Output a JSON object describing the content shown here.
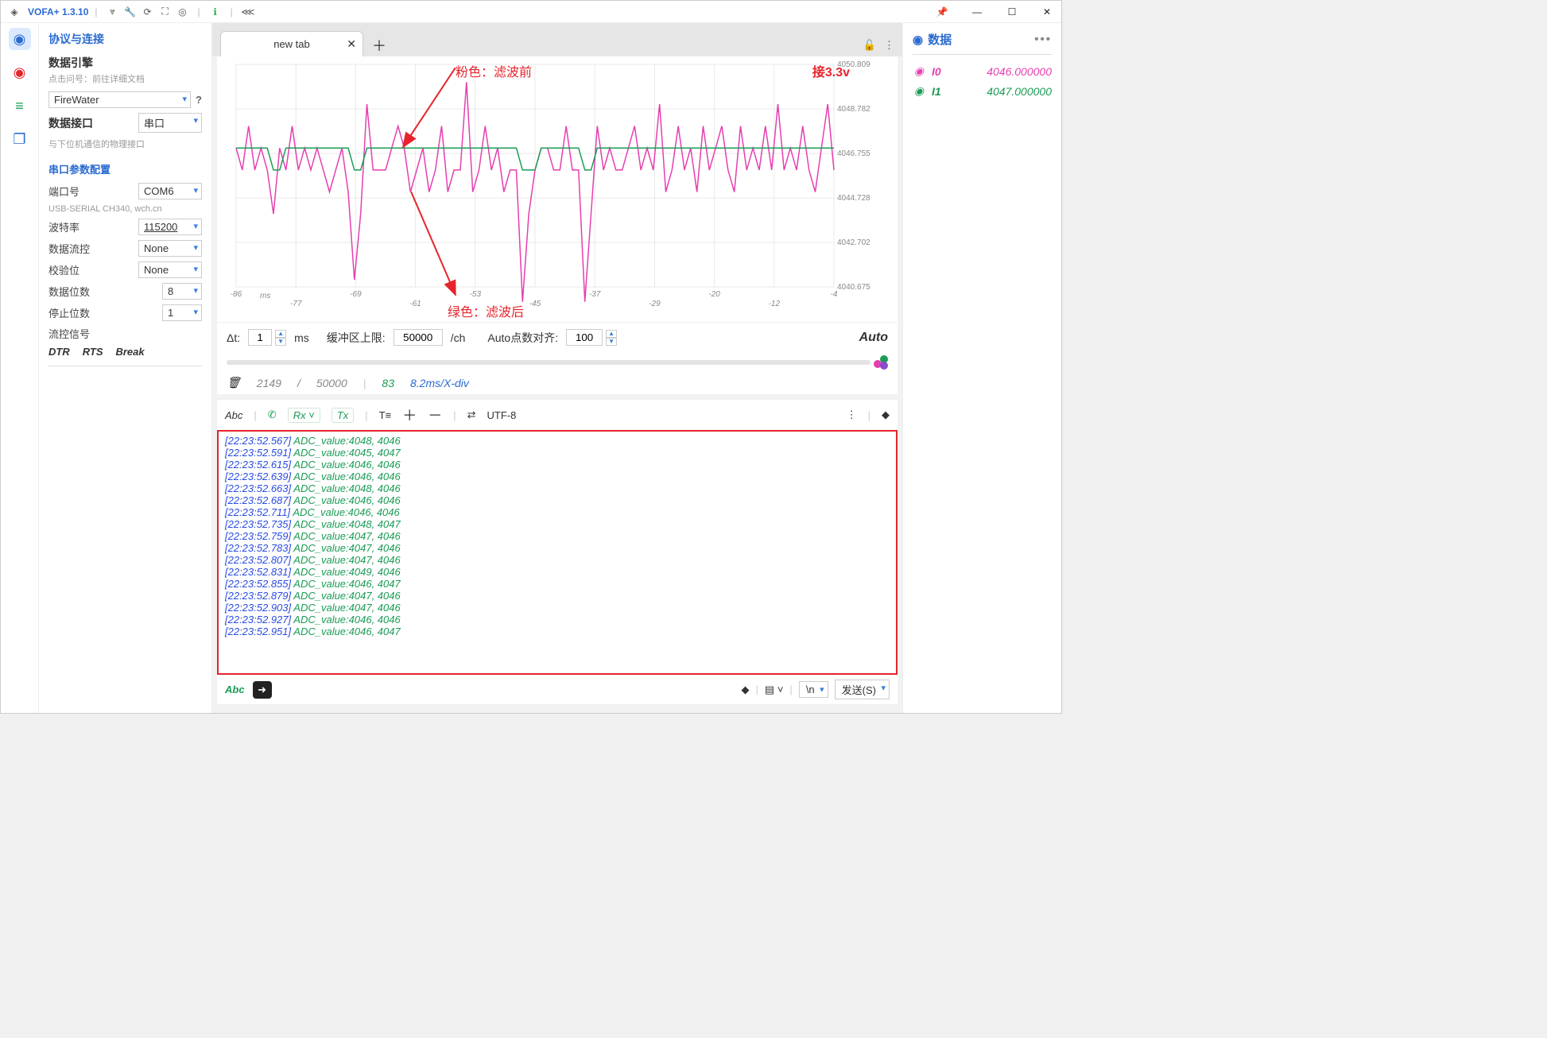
{
  "app": {
    "title": "VOFA+ 1.3.10"
  },
  "window_controls": {
    "pin": "📌",
    "min": "—",
    "max": "☐",
    "close": "✕"
  },
  "sidebar": {
    "title": "协议与连接",
    "engine_label": "数据引擎",
    "engine_sub": "点击问号：前往详细文档",
    "engine_value": "FireWater",
    "iface_label": "数据接口",
    "iface_value": "串口",
    "iface_sub": "与下位机通信的物理接口",
    "serial_title": "串口参数配置",
    "port_label": "端口号",
    "port_value": "COM6",
    "port_desc": "USB-SERIAL CH340, wch.cn",
    "baud_label": "波特率",
    "baud_value": "115200",
    "flow_label": "数据流控",
    "flow_value": "None",
    "parity_label": "校验位",
    "parity_value": "None",
    "databits_label": "数据位数",
    "databits_value": "8",
    "stopbits_label": "停止位数",
    "stopbits_value": "1",
    "flowsig_label": "流控信号",
    "dtr": "DTR",
    "rts": "RTS",
    "break": "Break"
  },
  "tabs": {
    "active": "new tab"
  },
  "chart_data": {
    "type": "line",
    "x_label": "ms",
    "x_ticks": [
      -86,
      -77,
      -69,
      -61,
      -53,
      -45,
      -37,
      -29,
      -20,
      -12,
      -4
    ],
    "ylim": [
      4040.675,
      4050.809
    ],
    "y_ticks": [
      4040.675,
      4042.702,
      4044.728,
      4046.755,
      4048.782,
      4050.809
    ],
    "series": [
      {
        "name": "I0",
        "color": "#e53fb0",
        "values": [
          4047,
          4046,
          4048,
          4046,
          4047,
          4046,
          4044,
          4047,
          4046,
          4048,
          4046,
          4047,
          4046,
          4047,
          4046,
          4045,
          4046,
          4047,
          4045,
          4041,
          4044,
          4049,
          4046,
          4046,
          4046,
          4047,
          4048,
          4047,
          4045,
          4046,
          4047,
          4045,
          4046,
          4048,
          4045,
          4046,
          4046,
          4050,
          4045,
          4046,
          4048,
          4046,
          4047,
          4045,
          4046,
          4046,
          4040,
          4044,
          4046,
          4047,
          4047,
          4046,
          4046,
          4048,
          4046,
          4046,
          4040,
          4044,
          4048,
          4046,
          4047,
          4046,
          4046,
          4047,
          4048,
          4046,
          4047,
          4046,
          4049,
          4045,
          4046,
          4048,
          4046,
          4047,
          4045,
          4048,
          4046,
          4047,
          4048,
          4046,
          4045,
          4048,
          4046,
          4047,
          4046,
          4048,
          4046,
          4049,
          4046,
          4047,
          4046,
          4048,
          4046,
          4045,
          4047,
          4049,
          4046
        ]
      },
      {
        "name": "I1",
        "color": "#1a9c55",
        "values": [
          4047,
          4047,
          4047,
          4047,
          4047,
          4047,
          4046,
          4046,
          4047,
          4047,
          4047,
          4047,
          4047,
          4047,
          4047,
          4047,
          4047,
          4047,
          4047,
          4046,
          4046,
          4047,
          4047,
          4047,
          4047,
          4047,
          4047,
          4047,
          4047,
          4047,
          4047,
          4047,
          4047,
          4047,
          4047,
          4047,
          4047,
          4047,
          4047,
          4047,
          4047,
          4047,
          4047,
          4047,
          4047,
          4047,
          4046,
          4046,
          4046,
          4047,
          4047,
          4047,
          4047,
          4047,
          4047,
          4047,
          4046,
          4046,
          4047,
          4047,
          4047,
          4047,
          4047,
          4047,
          4047,
          4047,
          4047,
          4047,
          4047,
          4047,
          4047,
          4047,
          4047,
          4047,
          4047,
          4047,
          4047,
          4047,
          4047,
          4047,
          4047,
          4047,
          4047,
          4047,
          4047,
          4047,
          4047,
          4047,
          4047,
          4047,
          4047,
          4047,
          4047,
          4047,
          4047,
          4047,
          4047
        ]
      }
    ],
    "annotations": {
      "pink_label": "粉色：滤波前",
      "green_label": "绿色：滤波后",
      "voltage": "接3.3v"
    }
  },
  "controls": {
    "dt_label": "Δt:",
    "dt_value": "1",
    "dt_unit": "ms",
    "buf_label": "缓冲区上限:",
    "buf_value": "50000",
    "buf_unit": "/ch",
    "align_label": "Auto点数对齐:",
    "align_value": "100",
    "auto": "Auto"
  },
  "status": {
    "cur": "2149",
    "sep": "/",
    "total": "50000",
    "bar": "|",
    "viscount": "83",
    "scale": "8.2ms/X-div"
  },
  "console_tb": {
    "abc": "Abc",
    "rx": "Rx",
    "tx": "Tx",
    "encoding": "UTF-8"
  },
  "console": [
    {
      "ts": "[22:23:52.567]",
      "msg": "ADC_value:4048, 4046"
    },
    {
      "ts": "[22:23:52.591]",
      "msg": "ADC_value:4045, 4047"
    },
    {
      "ts": "[22:23:52.615]",
      "msg": "ADC_value:4046, 4046"
    },
    {
      "ts": "[22:23:52.639]",
      "msg": "ADC_value:4046, 4046"
    },
    {
      "ts": "[22:23:52.663]",
      "msg": "ADC_value:4048, 4046"
    },
    {
      "ts": "[22:23:52.687]",
      "msg": "ADC_value:4046, 4046"
    },
    {
      "ts": "[22:23:52.711]",
      "msg": "ADC_value:4046, 4046"
    },
    {
      "ts": "[22:23:52.735]",
      "msg": "ADC_value:4048, 4047"
    },
    {
      "ts": "[22:23:52.759]",
      "msg": "ADC_value:4047, 4046"
    },
    {
      "ts": "[22:23:52.783]",
      "msg": "ADC_value:4047, 4046"
    },
    {
      "ts": "[22:23:52.807]",
      "msg": "ADC_value:4047, 4046"
    },
    {
      "ts": "[22:23:52.831]",
      "msg": "ADC_value:4049, 4046"
    },
    {
      "ts": "[22:23:52.855]",
      "msg": "ADC_value:4046, 4047"
    },
    {
      "ts": "[22:23:52.879]",
      "msg": "ADC_value:4047, 4046"
    },
    {
      "ts": "[22:23:52.903]",
      "msg": "ADC_value:4047, 4046"
    },
    {
      "ts": "[22:23:52.927]",
      "msg": "ADC_value:4046, 4046"
    },
    {
      "ts": "[22:23:52.951]",
      "msg": "ADC_value:4046, 4047"
    }
  ],
  "send": {
    "abc": "Abc",
    "newline": "\\n",
    "send_label": "发送(S)"
  },
  "panel": {
    "title": "数据",
    "rows": [
      {
        "name": "I0",
        "value": "4046.000000",
        "color": "pink"
      },
      {
        "name": "I1",
        "value": "4047.000000",
        "color": "green"
      }
    ]
  }
}
